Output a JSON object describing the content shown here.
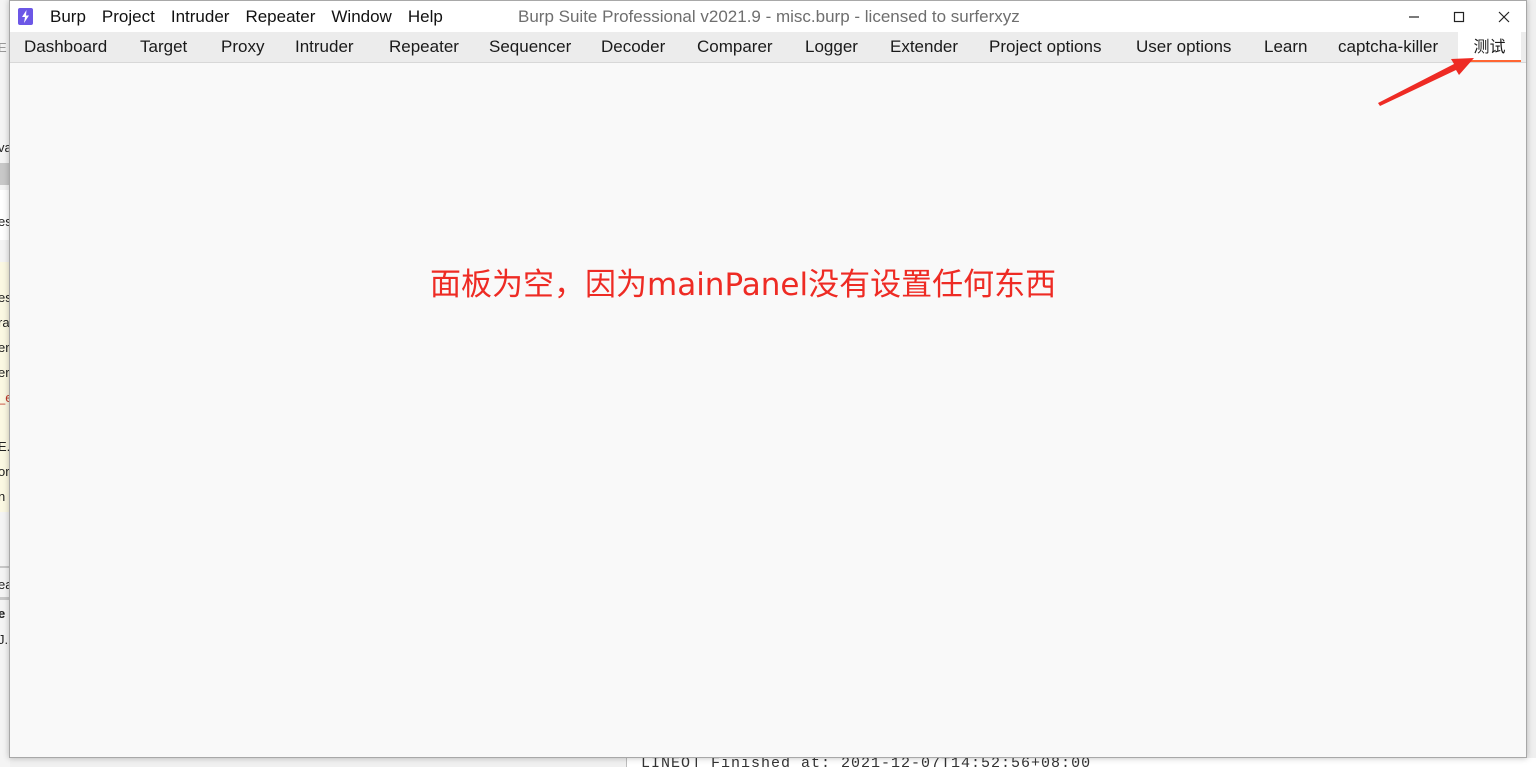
{
  "window": {
    "app_icon": "burp-lightning-icon",
    "title": "Burp Suite Professional v2021.9 - misc.burp - licensed to surferxyz",
    "controls": [
      "minimize-icon",
      "maximize-icon",
      "close-icon"
    ]
  },
  "menu": {
    "items": [
      "Burp",
      "Project",
      "Intruder",
      "Repeater",
      "Window",
      "Help"
    ]
  },
  "tabs": {
    "items": [
      "Dashboard",
      "Target",
      "Proxy",
      "Intruder",
      "Repeater",
      "Sequencer",
      "Decoder",
      "Comparer",
      "Logger",
      "Extender",
      "Project options",
      "User options",
      "Learn",
      "captcha-killer",
      "测试"
    ],
    "active": "测试"
  },
  "annotation": {
    "text": "面板为空，因为mainPanel没有设置任何东西",
    "color": "#ee2b24"
  },
  "background": {
    "left_fragments": [
      "E",
      "va",
      "es",
      "es",
      "ra",
      "er",
      "er",
      "_e",
      "l",
      "E.",
      "or",
      "n",
      "ea",
      "e",
      "J."
    ],
    "bottom_text": "LINEO] Finished at: 2021-12-07T14:52:56+08:00"
  },
  "colors": {
    "accent_tab_underline": "#ff6633",
    "app_icon": "#6c57e6",
    "tabbar_bg": "#ececec",
    "panel_bg": "#f9f9f9"
  }
}
